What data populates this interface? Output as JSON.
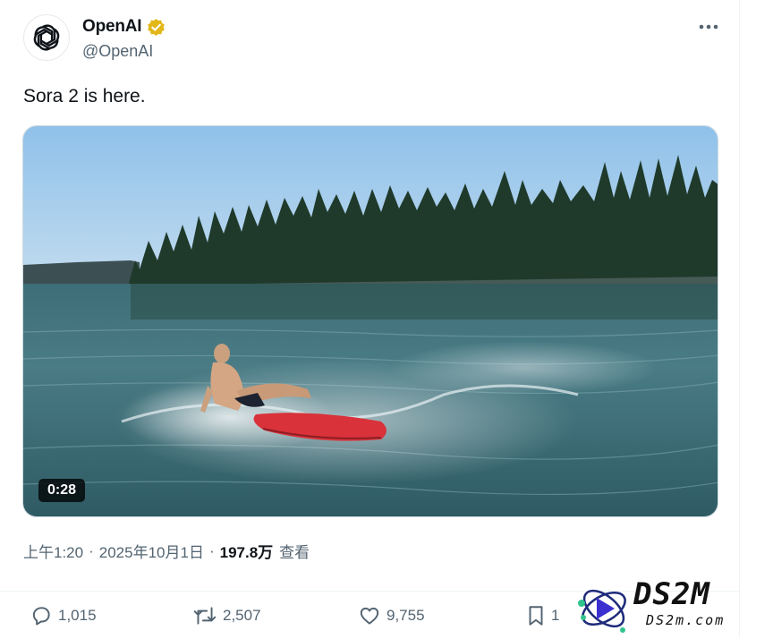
{
  "author": {
    "display_name": "OpenAI",
    "handle": "@OpenAI",
    "avatar_icon": "openai-logo-icon",
    "verified_badge_color": "#e2b719"
  },
  "header": {
    "more_icon": "more-horizontal-icon"
  },
  "tweet": {
    "text": "Sora 2 is here."
  },
  "media": {
    "duration": "0:28",
    "type": "video"
  },
  "meta": {
    "time": "上午1:20",
    "separator": "·",
    "date": "2025年10月1日",
    "views_count": "197.8万",
    "views_label": "查看"
  },
  "actions": {
    "reply": {
      "icon": "reply-icon",
      "count": "1,015"
    },
    "repost": {
      "icon": "repost-icon",
      "count": "2,507"
    },
    "like": {
      "icon": "heart-icon",
      "count": "9,755"
    },
    "bookmark": {
      "icon": "bookmark-icon",
      "count": "1"
    }
  },
  "watermark": {
    "text": "DS2M",
    "sub": "DS2m.com"
  },
  "colors": {
    "text_primary": "#0f1419",
    "text_secondary": "#536471",
    "divider": "#eff3f4"
  }
}
